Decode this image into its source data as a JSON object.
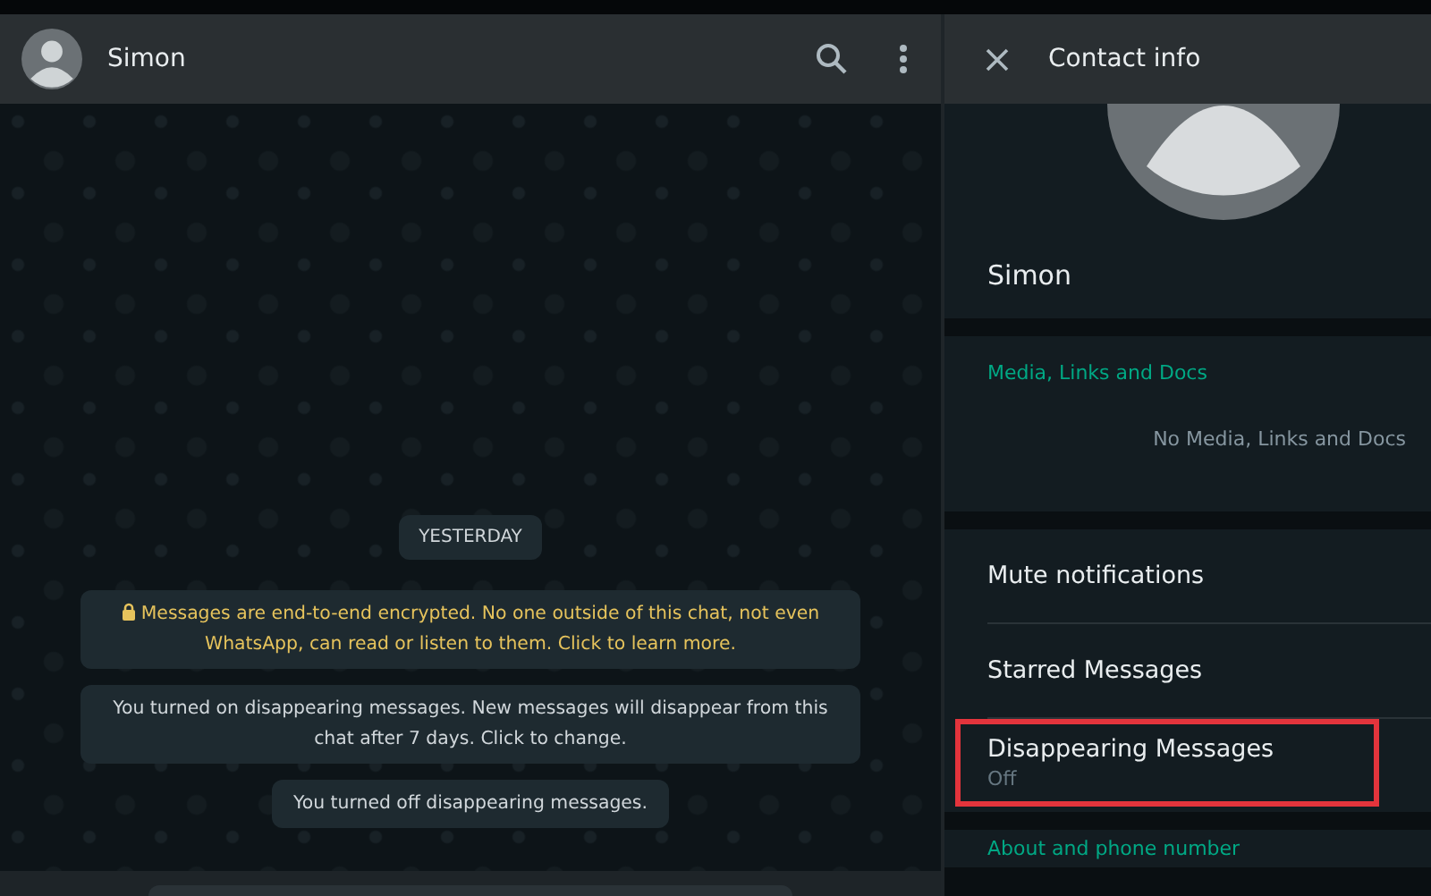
{
  "chat": {
    "header": {
      "name": "Simon"
    },
    "date_chip": "YESTERDAY",
    "messages": [
      {
        "kind": "encryption",
        "text": "Messages are end-to-end encrypted. No one outside of this chat, not even WhatsApp, can read or listen to them. Click to learn more."
      },
      {
        "kind": "system",
        "text": "You turned on disappearing messages. New messages will disappear from this chat after 7 days. Click to change."
      },
      {
        "kind": "system",
        "text": "You turned off disappearing messages."
      }
    ]
  },
  "contact_info": {
    "title": "Contact info",
    "name": "Simon",
    "media": {
      "heading": "Media, Links and Docs",
      "empty_text": "No Media, Links and Docs"
    },
    "items": [
      {
        "label": "Mute notifications",
        "highlighted": false
      },
      {
        "label": "Starred Messages",
        "highlighted": false
      },
      {
        "label": "Disappearing Messages",
        "subtitle": "Off",
        "highlighted": true
      }
    ],
    "about_heading": "About and phone number"
  }
}
